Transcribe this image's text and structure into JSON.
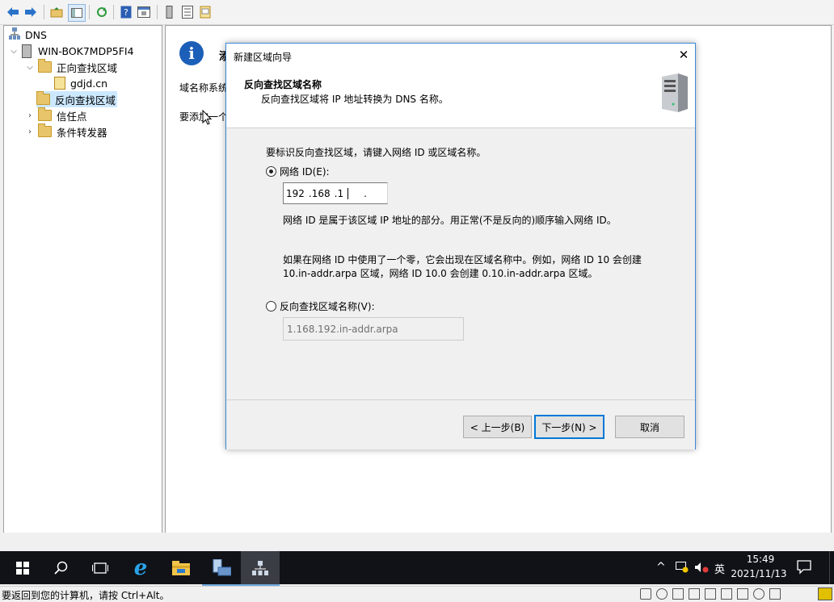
{
  "tree": {
    "root": "DNS",
    "server": "WIN-BOK7MDP5FI4",
    "items": [
      {
        "label": "正向查找区域"
      },
      {
        "label": "gdjd.cn"
      },
      {
        "label": "反向查找区域"
      },
      {
        "label": "信任点"
      },
      {
        "label": "条件转发器"
      }
    ]
  },
  "background_pane": {
    "heading_partial": "添",
    "line1_partial": "域名称系统",
    "line2_partial": "要添加一个"
  },
  "dialog": {
    "title": "新建区域向导",
    "header_title": "反向查找区域名称",
    "header_subtitle": "反向查找区域将 IP 地址转换为 DNS 名称。",
    "instruction": "要标识反向查找区域，请键入网络 ID 或区域名称。",
    "network_id_label": "网络 ID(E):",
    "ip_octet1": "192",
    "ip_octet2": ".168",
    "ip_octet3": ".1",
    "ip_octet4": ".",
    "help1": "网络 ID 是属于该区域 IP 地址的部分。用正常(不是反向的)顺序输入网络 ID。",
    "help2_line1": "如果在网络 ID 中使用了一个零，它会出现在区域名称中。例如，网络 ID 10 会创建",
    "help2_line2": "10.in-addr.arpa 区域，网络 ID 10.0 会创建 0.10.in-addr.arpa 区域。",
    "zone_name_label": "反向查找区域名称(V):",
    "zone_name_value": "1.168.192.in-addr.arpa",
    "back_button": "< 上一步(B)",
    "next_button": "下一步(N) >",
    "cancel_button": "取消",
    "close_glyph": "✕"
  },
  "taskbar": {
    "time": "15:49",
    "date": "2021/11/13",
    "ime": "英"
  },
  "host_status": "要返回到您的计算机，请按 Ctrl+Alt。"
}
